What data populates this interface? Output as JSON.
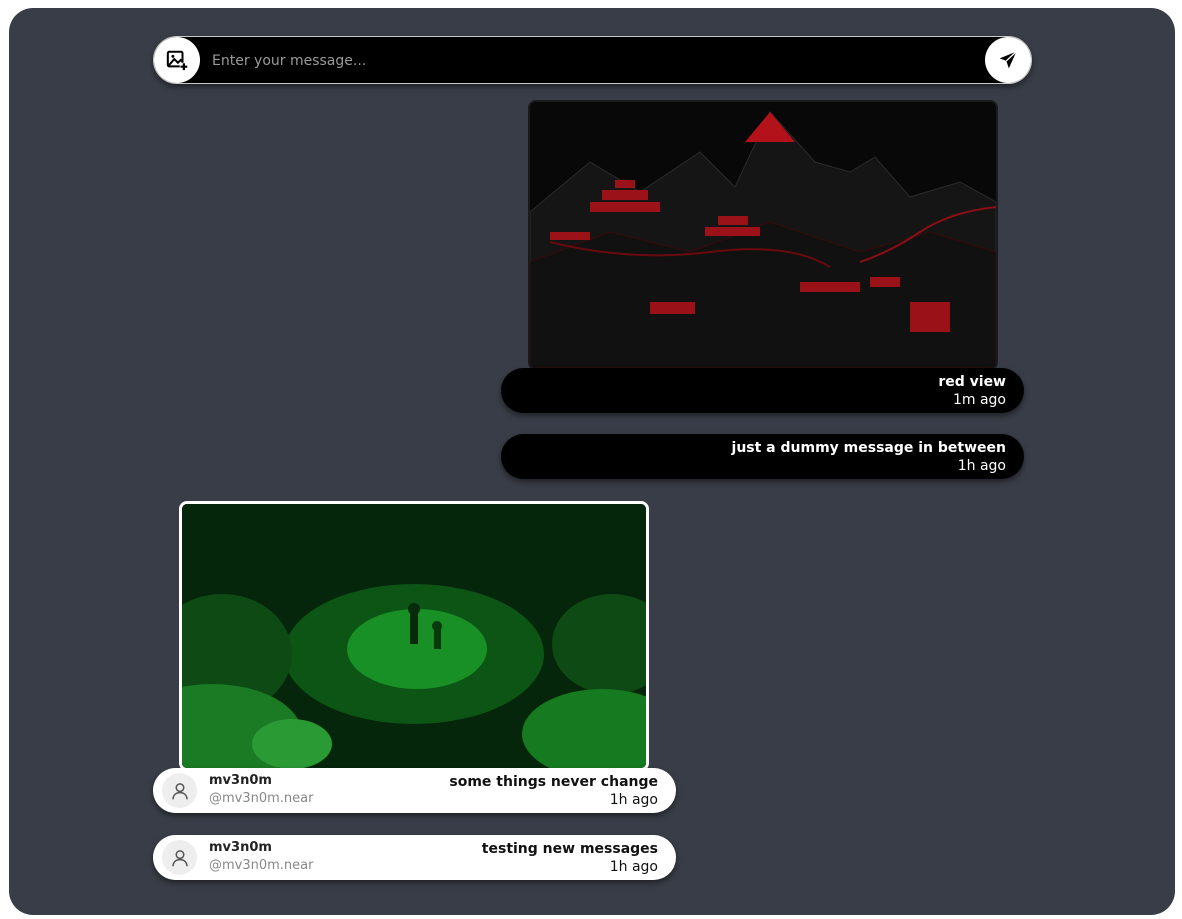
{
  "composer": {
    "placeholder": "Enter your message..."
  },
  "messages": [
    {
      "text": "red view",
      "time": "1m ago",
      "image_alt": "red temple landscape"
    },
    {
      "text": "just a dummy message in between",
      "time": "1h ago"
    },
    {
      "text": "some things never change",
      "time": "1h ago",
      "user": "mv3n0m",
      "handle": "@mv3n0m.near",
      "image_alt": "green forest scene"
    },
    {
      "text": "testing new messages",
      "time": "1h ago",
      "user": "mv3n0m",
      "handle": "@mv3n0m.near"
    }
  ],
  "colors": {
    "background": "#393d47",
    "own_bubble": "#000000",
    "other_bubble": "#ffffff"
  }
}
